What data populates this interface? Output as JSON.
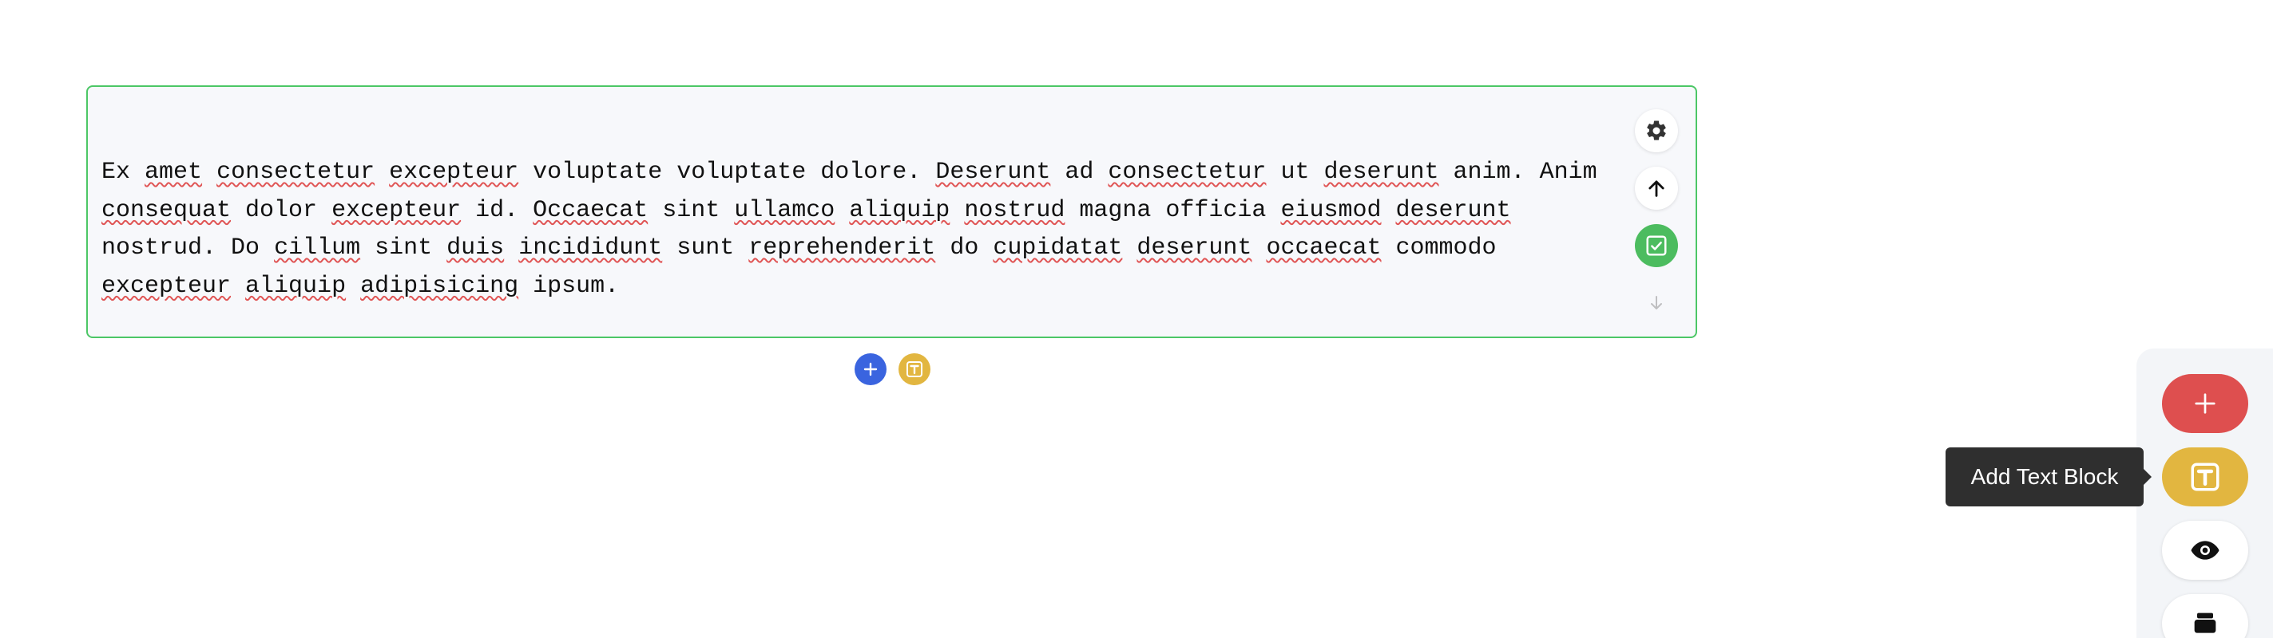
{
  "text_block": {
    "words": [
      {
        "t": "Ex",
        "u": false
      },
      {
        "t": "amet",
        "u": true
      },
      {
        "t": "consectetur",
        "u": true
      },
      {
        "t": "excepteur",
        "u": true
      },
      {
        "t": "voluptate",
        "u": false
      },
      {
        "t": "voluptate",
        "u": false
      },
      {
        "t": "dolore.",
        "u": false
      },
      {
        "t": "Deserunt",
        "u": true
      },
      {
        "t": "ad",
        "u": false
      },
      {
        "t": "consectetur",
        "u": true
      },
      {
        "t": "ut",
        "u": false
      },
      {
        "t": "deserunt",
        "u": true
      },
      {
        "t": "anim.",
        "u": false
      },
      {
        "t": "Anim",
        "u": false
      },
      {
        "t": "consequat",
        "u": true
      },
      {
        "t": "dolor",
        "u": false
      },
      {
        "t": "excepteur",
        "u": true
      },
      {
        "t": "id.",
        "u": false
      },
      {
        "t": "Occaecat",
        "u": true
      },
      {
        "t": "sint",
        "u": false
      },
      {
        "t": "ullamco",
        "u": true
      },
      {
        "t": "aliquip",
        "u": true
      },
      {
        "t": "nostrud",
        "u": true
      },
      {
        "t": "magna",
        "u": false
      },
      {
        "t": "officia",
        "u": false
      },
      {
        "t": "eiusmod",
        "u": true
      },
      {
        "t": "deserunt",
        "u": true
      },
      {
        "t": "nostrud.",
        "u": false
      },
      {
        "t": "Do",
        "u": false
      },
      {
        "t": "cillum",
        "u": true
      },
      {
        "t": "sint",
        "u": false
      },
      {
        "t": "duis",
        "u": true
      },
      {
        "t": "incididunt",
        "u": true
      },
      {
        "t": "sunt",
        "u": false
      },
      {
        "t": "reprehenderit",
        "u": true
      },
      {
        "t": "do",
        "u": false
      },
      {
        "t": "cupidatat",
        "u": true
      },
      {
        "t": "deserunt",
        "u": true
      },
      {
        "t": "occaecat",
        "u": true
      },
      {
        "t": "commodo",
        "u": false
      },
      {
        "t": "excepteur",
        "u": true
      },
      {
        "t": "aliquip",
        "u": true
      },
      {
        "t": "adipisicing",
        "u": true
      },
      {
        "t": "ipsum.",
        "u": false
      }
    ],
    "controls": {
      "settings_icon": "gear-icon",
      "move_up_icon": "arrow-up-icon",
      "accept_icon": "check-square-icon",
      "move_down_icon": "arrow-down-icon"
    }
  },
  "inline_actions": {
    "add_icon": "plus-icon",
    "text_icon": "text-block-icon"
  },
  "fab_panel": {
    "buttons": [
      "add",
      "add-text-block",
      "preview",
      "stack"
    ],
    "tooltip": "Add Text Block"
  },
  "colors": {
    "block_border": "#4cc766",
    "accept_green": "#4cbc5f",
    "add_blue": "#3a64df",
    "text_yellow": "#e2b640",
    "add_red": "#de4f4f",
    "tooltip_bg": "#2f2f2f"
  }
}
